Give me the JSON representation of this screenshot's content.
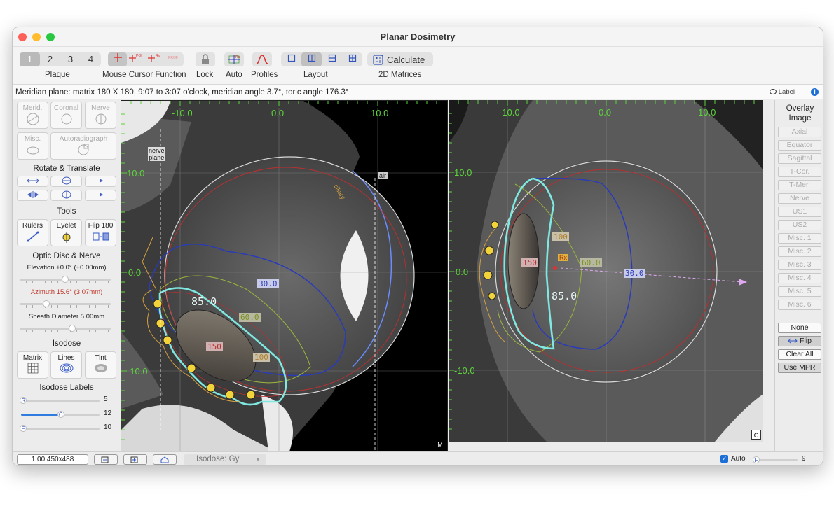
{
  "window": {
    "title": "Planar Dosimetry"
  },
  "toolbar": {
    "plaque_tabs": [
      "1",
      "2",
      "3",
      "4"
    ],
    "plaque_label": "Plaque",
    "cursor_label": "Mouse Cursor Function",
    "lock_label": "Lock",
    "auto_label": "Auto",
    "profiles_label": "Profiles",
    "layout_label": "Layout",
    "calculate_label": "Calculate",
    "matrices_label": "2D Matrices"
  },
  "infobar": {
    "text": "Meridian plane: matrix 180 X 180, 9:07 to 3:07 o'clock, meridian angle 3.7°, toric angle 176.3°",
    "label_text": "Label"
  },
  "sidebar": {
    "view_buttons": [
      "Merid.",
      "Coronal",
      "Nerve",
      "Misc.",
      "Autoradiograph"
    ],
    "rotate_heading": "Rotate & Translate",
    "tools_heading": "Tools",
    "tools": [
      "Rulers",
      "Eyelet",
      "Flip 180"
    ],
    "optic_heading": "Optic Disc & Nerve",
    "elevation": "Elevation +0.0° (+0.00mm)",
    "azimuth": "Azimuth 15.6° (3.07mm)",
    "sheath": "Sheath Diameter 5.00mm",
    "isodose_heading": "Isodose",
    "isodose_buttons": [
      "Matrix",
      "Lines",
      "Tint"
    ],
    "labels_heading": "Isodose Labels",
    "sliders": [
      {
        "letter": "S",
        "value": "5",
        "fraction": 0.0
      },
      {
        "letter": "C",
        "value": "12",
        "fraction": 0.48
      },
      {
        "letter": "F",
        "value": "10",
        "fraction": 0.0
      }
    ]
  },
  "left_view": {
    "top_ticks": [
      "-10.0",
      "0.0",
      "10.0"
    ],
    "left_ticks": [
      "10.0",
      "0.0",
      "-10.0"
    ],
    "isodose_labels": [
      "85.0",
      "30.0",
      "60.0",
      "150",
      "100"
    ],
    "nerve_label": [
      "nerve",
      "plane"
    ],
    "air_label": "air",
    "ciliary_label": "ciliary",
    "corner": "M"
  },
  "right_view": {
    "top_ticks": [
      "-10.0",
      "0.0",
      "10.0"
    ],
    "left_ticks": [
      "10.0",
      "0.0",
      "-10.0"
    ],
    "isodose_labels": [
      "100",
      "150",
      "60.0",
      "30.0",
      "85.0"
    ],
    "rx_label": "Rx",
    "corner": "C"
  },
  "overlay": {
    "heading": "Overlay Image",
    "items": [
      "Axial",
      "Equator",
      "Sagittal",
      "T-Cor.",
      "T-Mer.",
      "Nerve",
      "US1",
      "US2",
      "Misc. 1",
      "Misc. 2",
      "Misc. 3",
      "Misc. 4",
      "Misc. 5",
      "Misc. 6"
    ],
    "none": "None",
    "flip": "Flip",
    "clear_all": "Clear All",
    "use_mpr": "Use MPR"
  },
  "statusbar": {
    "zoom": "1.00 450x488",
    "isodose_select": "Isodose: Gy",
    "auto_label": "Auto",
    "f_letter": "F",
    "f_value": "9"
  },
  "colors": {
    "grid_label": "#5cd43a",
    "iso_85": "#7fe8e0",
    "iso_30": "#2a3bb8",
    "iso_60": "#9bb83a",
    "iso_100": "#d4a040",
    "iso_150": "#b83030",
    "sclera": "#e8e8e8"
  }
}
